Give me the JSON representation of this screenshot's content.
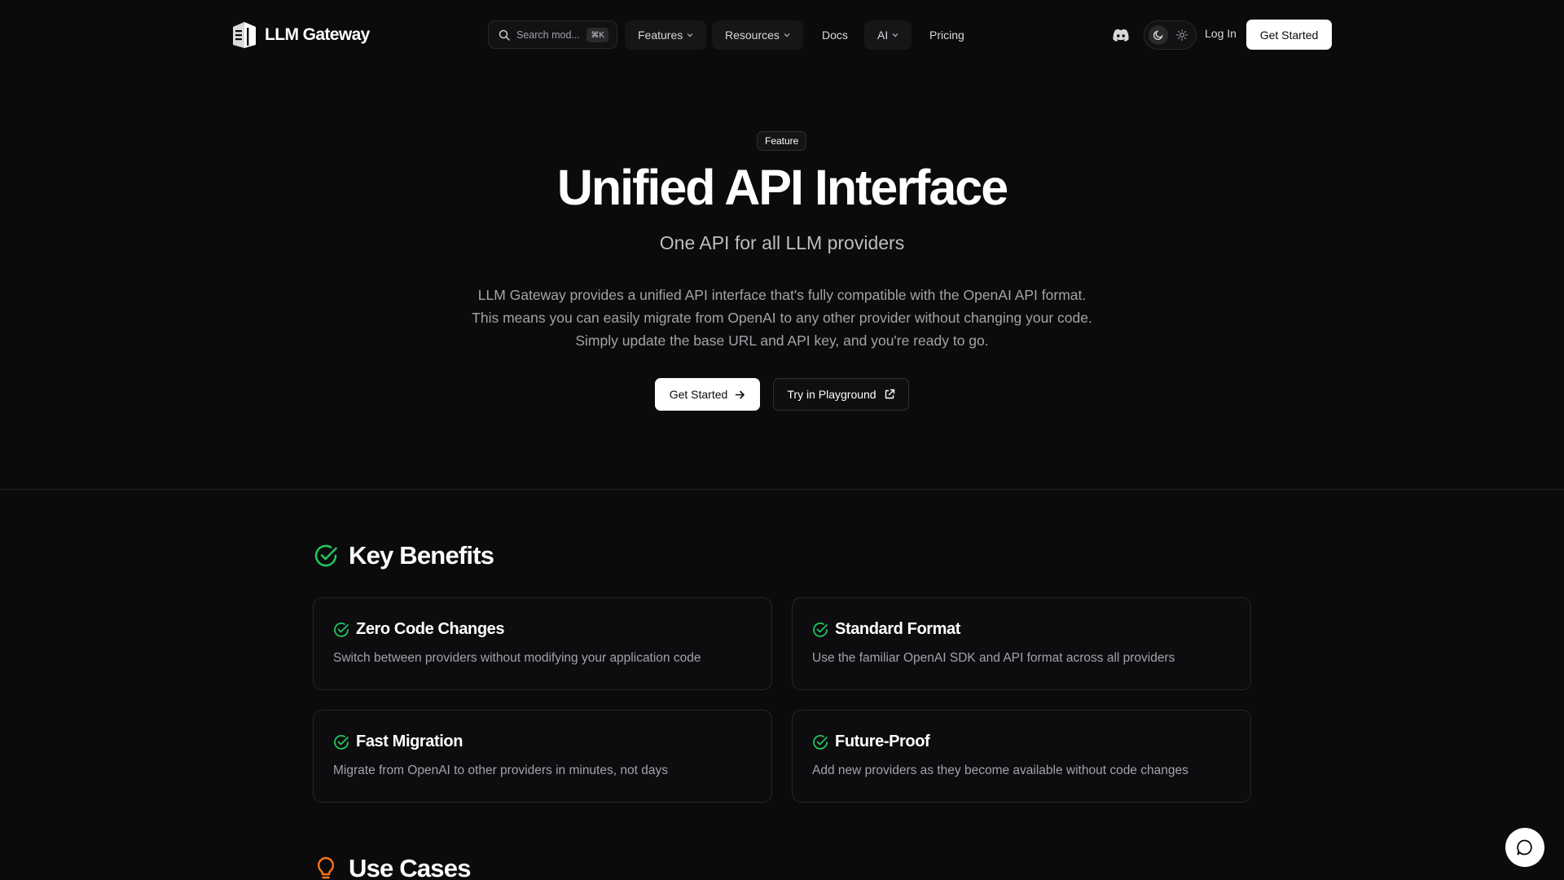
{
  "nav": {
    "logo_text": "LLM Gateway",
    "search_placeholder": "Search mod...",
    "search_shortcut": "⌘K",
    "items": [
      {
        "label": "Features",
        "dropdown": true
      },
      {
        "label": "Resources",
        "dropdown": true
      },
      {
        "label": "Docs",
        "dropdown": false
      },
      {
        "label": "AI",
        "dropdown": true
      },
      {
        "label": "Pricing",
        "dropdown": false
      }
    ],
    "login_label": "Log In",
    "cta_label": "Get Started"
  },
  "hero": {
    "badge": "Feature",
    "title": "Unified API Interface",
    "subtitle": "One API for all LLM providers",
    "description": "LLM Gateway provides a unified API interface that's fully compatible with the OpenAI API format. This means you can easily migrate from OpenAI to any other provider without changing your code. Simply update the base URL and API key, and you're ready to go.",
    "primary_button": "Get Started",
    "secondary_button": "Try in Playground"
  },
  "benefits": {
    "title": "Key Benefits",
    "cards": [
      {
        "title": "Zero Code Changes",
        "description": "Switch between providers without modifying your application code"
      },
      {
        "title": "Standard Format",
        "description": "Use the familiar OpenAI SDK and API format across all providers"
      },
      {
        "title": "Fast Migration",
        "description": "Migrate from OpenAI to other providers in minutes, not days"
      },
      {
        "title": "Future-Proof",
        "description": "Add new providers as they become available without code changes"
      }
    ]
  },
  "use_cases": {
    "title": "Use Cases"
  },
  "colors": {
    "background": "#0b0b0c",
    "accent_green": "#22c55e",
    "accent_orange": "#f97316"
  }
}
